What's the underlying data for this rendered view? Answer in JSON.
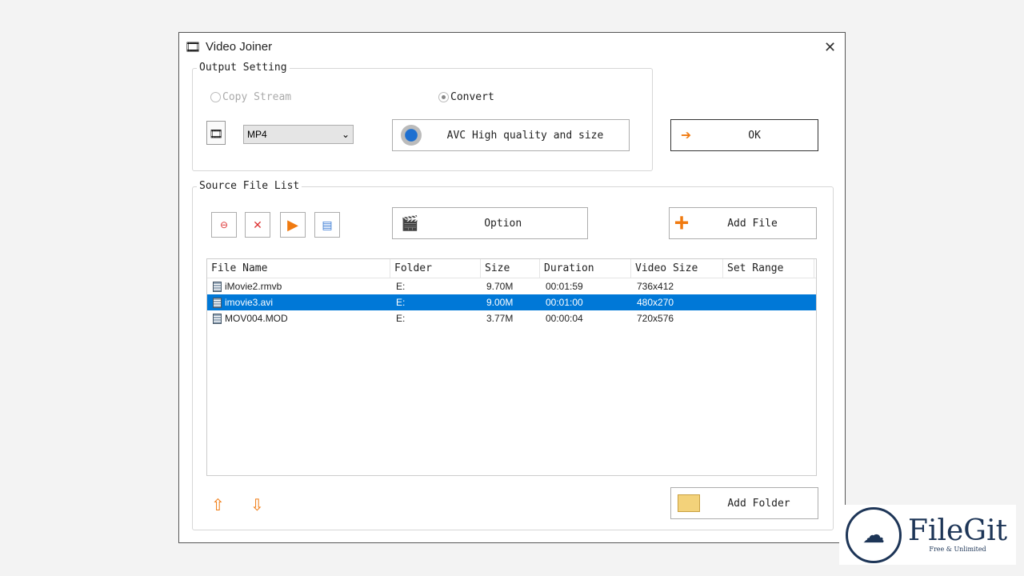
{
  "window": {
    "title": "Video Joiner",
    "close": "✕"
  },
  "output_setting": {
    "legend": "Output Setting",
    "copy_stream": "Copy Stream",
    "convert": "Convert",
    "selected_mode": "Convert",
    "format": "MP4",
    "preset": "AVC High quality and size",
    "ok": "OK"
  },
  "source": {
    "legend": "Source File List",
    "option": "Option",
    "add_file": "Add File",
    "add_folder": "Add Folder",
    "columns": [
      "File Name",
      "Folder",
      "Size",
      "Duration",
      "Video Size",
      "Set Range"
    ],
    "rows": [
      {
        "name": "iMovie2.rmvb",
        "folder": "E:",
        "size": "9.70M",
        "duration": "00:01:59",
        "video_size": "736x412",
        "range": "",
        "selected": false
      },
      {
        "name": "imovie3.avi",
        "folder": "E:",
        "size": "9.00M",
        "duration": "00:01:00",
        "video_size": "480x270",
        "range": "",
        "selected": true
      },
      {
        "name": "MOV004.MOD",
        "folder": "E:",
        "size": "3.77M",
        "duration": "00:00:04",
        "video_size": "720x576",
        "range": "",
        "selected": false
      }
    ]
  },
  "colors": {
    "selection": "#0078d7",
    "accent_orange": "#f07a10"
  },
  "watermark": {
    "brand": "FileGit",
    "tagline": "Free & Unlimited"
  }
}
